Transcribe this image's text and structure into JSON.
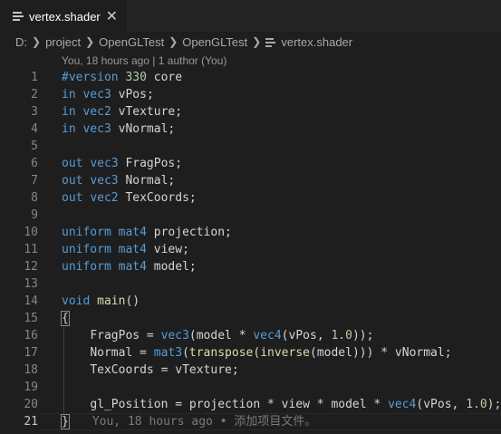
{
  "tab": {
    "label": "vertex.shader",
    "close": "✕"
  },
  "breadcrumb": [
    "D:",
    "project",
    "OpenGLTest",
    "OpenGLTest",
    "vertex.shader"
  ],
  "codelens": "You, 18 hours ago | 1 author (You)",
  "blame": "You, 18 hours ago • 添加项目文件。",
  "lines": [
    {
      "n": "1",
      "code": "#version 330 core"
    },
    {
      "n": "2",
      "code": "in vec3 vPos;"
    },
    {
      "n": "3",
      "code": "in vec2 vTexture;"
    },
    {
      "n": "4",
      "code": "in vec3 vNormal;"
    },
    {
      "n": "5",
      "code": ""
    },
    {
      "n": "6",
      "code": "out vec3 FragPos;"
    },
    {
      "n": "7",
      "code": "out vec3 Normal;"
    },
    {
      "n": "8",
      "code": "out vec2 TexCoords;"
    },
    {
      "n": "9",
      "code": ""
    },
    {
      "n": "10",
      "code": "uniform mat4 projection;"
    },
    {
      "n": "11",
      "code": "uniform mat4 view;"
    },
    {
      "n": "12",
      "code": "uniform mat4 model;"
    },
    {
      "n": "13",
      "code": ""
    },
    {
      "n": "14",
      "code": "void main()"
    },
    {
      "n": "15",
      "code": "{"
    },
    {
      "n": "16",
      "code": "    FragPos = vec3(model * vec4(vPos, 1.0));"
    },
    {
      "n": "17",
      "code": "    Normal = mat3(transpose(inverse(model))) * vNormal;"
    },
    {
      "n": "18",
      "code": "    TexCoords = vTexture;"
    },
    {
      "n": "19",
      "code": ""
    },
    {
      "n": "20",
      "code": "    gl_Position = projection * view * model * vec4(vPos, 1.0);"
    },
    {
      "n": "21",
      "code": "}"
    }
  ],
  "active_line": "21",
  "colors": {
    "keyword": "#569cd6",
    "number": "#b5cea8",
    "function": "#dcdcaa",
    "text": "#d4d4d4",
    "background": "#1e1e1e"
  }
}
